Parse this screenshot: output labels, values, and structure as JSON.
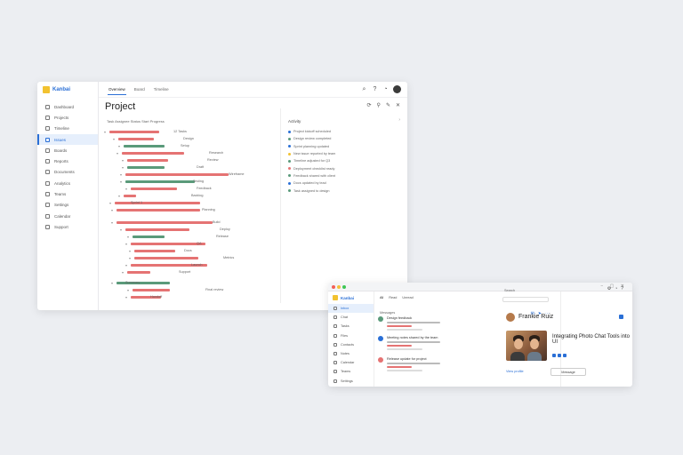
{
  "colors": {
    "accent": "#2a6fd6",
    "bar_red": "#e57373",
    "bar_green": "#5a9a7a",
    "logo_yellow": "#f2c230"
  },
  "main_window": {
    "logo": "Kanbai",
    "nav": [
      "Dashboard",
      "Projects",
      "Timeline",
      "Issues",
      "Boards",
      "Reports",
      "Documents",
      "Analytics",
      "Teams",
      "Settings",
      "Calendar",
      "Support"
    ],
    "tabs": [
      "Overview",
      "Board",
      "Timeline"
    ],
    "title": "Project",
    "subtitle": "Task  Assignee  Status  Start  Progress",
    "tasks": [
      "12 Tasks",
      "Design",
      "Setup",
      "Research",
      "Review",
      "Draft",
      "Wireframe",
      "Testing",
      "Feedback",
      "Backlog",
      "Sprint 1",
      "Planning",
      "Build",
      "Deploy",
      "Release",
      "QA",
      "Docs",
      "Metrics",
      "Launch",
      "Support",
      "Summary",
      "Final review",
      "Handoff"
    ],
    "right_panel": {
      "heading": "Activity",
      "items": [
        "Project kickoff scheduled",
        "Design review completed",
        "Sprint planning updated",
        "New issue reported by team",
        "Timeline adjusted for Q3",
        "Deployment checklist ready",
        "Feedback shared with client",
        "Docs updated by lead",
        "Task assigned to design"
      ]
    }
  },
  "second_window": {
    "logo": "Kanbai",
    "nav": [
      "Inbox",
      "Chat",
      "Tasks",
      "Files",
      "Contacts",
      "Notes",
      "Calendar",
      "Teams",
      "Settings",
      "Help"
    ],
    "tabs": [
      "All",
      "Read",
      "Unread"
    ],
    "sublabel": "Messages",
    "messages": [
      "Design feedback",
      "Meeting notes shared by the team",
      "Release update for project"
    ],
    "contact": {
      "name": "Frankie Ruiz",
      "headline": "Integrating Photo Chat Tools into UI",
      "link": "View profile",
      "button": "Message"
    },
    "search_label": "Search"
  }
}
